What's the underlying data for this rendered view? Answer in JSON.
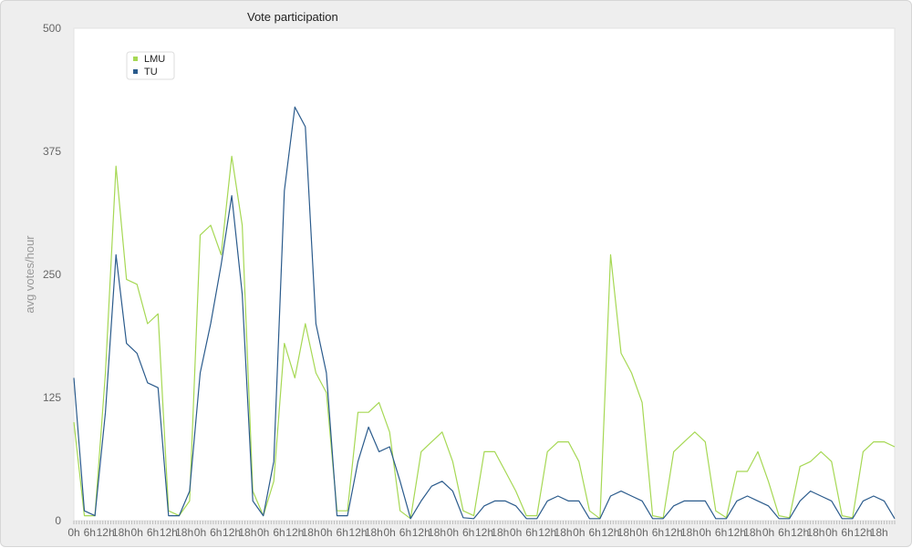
{
  "chart_data": {
    "type": "line",
    "title": "Vote participation",
    "xlabel": "",
    "ylabel": "avg votes/hour",
    "ylim": [
      0,
      500
    ],
    "y_ticks": [
      0,
      125,
      250,
      375,
      500
    ],
    "x_tick_labels_cycle": [
      "0h",
      "6h",
      "12h",
      "18h"
    ],
    "days": 13,
    "grid": false,
    "legend_position": "top-left",
    "x": [
      "0h",
      "6h",
      "12h",
      "18h",
      "0h",
      "6h",
      "12h",
      "18h",
      "0h",
      "6h",
      "12h",
      "18h",
      "0h",
      "6h",
      "12h",
      "18h",
      "0h",
      "6h",
      "12h",
      "18h",
      "0h",
      "6h",
      "12h",
      "18h",
      "0h",
      "6h",
      "12h",
      "18h",
      "0h",
      "6h",
      "12h",
      "18h",
      "0h",
      "6h",
      "12h",
      "18h",
      "0h",
      "6h",
      "12h",
      "18h",
      "0h",
      "6h",
      "12h",
      "18h",
      "0h",
      "6h",
      "12h",
      "18h",
      "0h",
      "6h",
      "12h",
      "18h"
    ],
    "series": [
      {
        "name": "LMU",
        "color": "#a6d854",
        "values": [
          100,
          5,
          5,
          150,
          360,
          245,
          240,
          200,
          210,
          10,
          5,
          20,
          290,
          300,
          270,
          370,
          300,
          30,
          5,
          40,
          180,
          145,
          200,
          150,
          130,
          10,
          10,
          110,
          110,
          120,
          90,
          10,
          2,
          70,
          80,
          90,
          60,
          10,
          5,
          70,
          70,
          50,
          30,
          5,
          5,
          70,
          80,
          80,
          60,
          10,
          2,
          270,
          170,
          150,
          120,
          5,
          3,
          70,
          80,
          90,
          80,
          10,
          3,
          50,
          50,
          70,
          40,
          5,
          3,
          55,
          60,
          70,
          60,
          5,
          3,
          70,
          80,
          80,
          75
        ]
      },
      {
        "name": "TU",
        "color": "#2b5b8c",
        "values": [
          145,
          10,
          5,
          110,
          270,
          180,
          170,
          140,
          135,
          5,
          5,
          30,
          150,
          200,
          260,
          330,
          230,
          20,
          5,
          60,
          335,
          420,
          400,
          200,
          150,
          5,
          5,
          60,
          95,
          70,
          75,
          40,
          2,
          20,
          35,
          40,
          30,
          3,
          2,
          15,
          20,
          20,
          15,
          2,
          2,
          20,
          25,
          20,
          20,
          2,
          2,
          25,
          30,
          25,
          20,
          2,
          2,
          15,
          20,
          20,
          20,
          2,
          2,
          20,
          25,
          20,
          15,
          2,
          2,
          20,
          30,
          25,
          20,
          2,
          2,
          20,
          25,
          20,
          2
        ]
      }
    ]
  }
}
